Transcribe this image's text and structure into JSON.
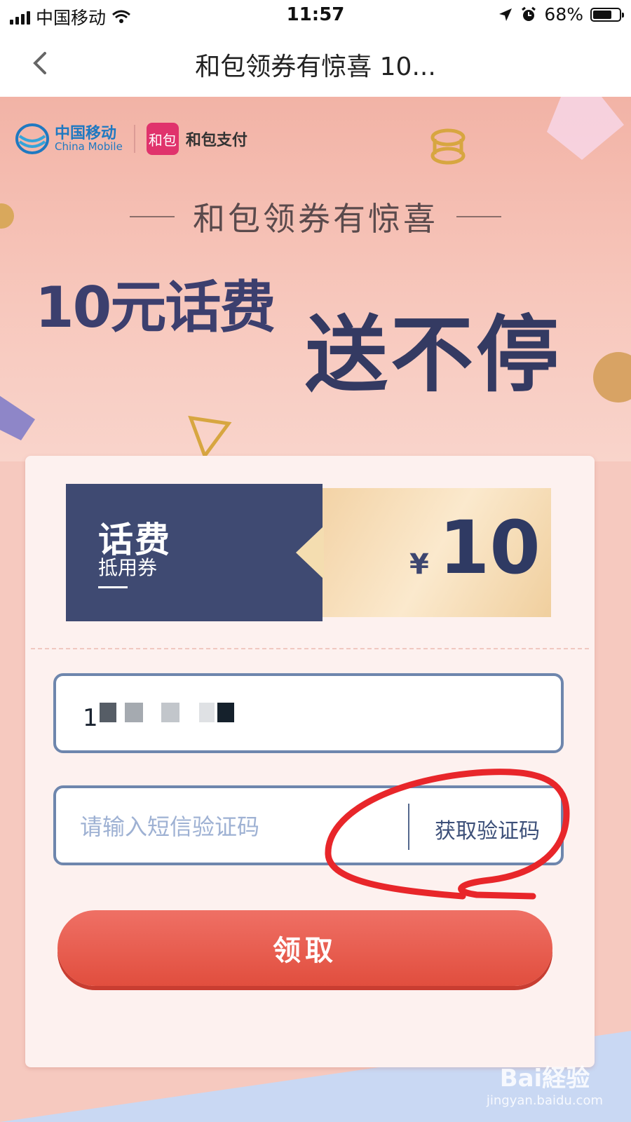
{
  "status_bar": {
    "carrier": "中国移动",
    "time": "11:57",
    "battery": "68%"
  },
  "nav": {
    "title": "和包领券有惊喜 10..."
  },
  "banner": {
    "brand_cn": "中国移动",
    "brand_en": "China Mobile",
    "hebao_icon": "和包",
    "hebao_text": "和包支付",
    "subtitle": "和包领券有惊喜",
    "headline_1": "10元话费",
    "headline_2": "送不停"
  },
  "coupon": {
    "title": "话费",
    "subtitle": "抵用券",
    "currency": "¥",
    "amount": "10"
  },
  "form": {
    "phone_value": "1",
    "code_placeholder": "请输入短信验证码",
    "get_code_label": "获取验证码",
    "claim_label": "领取"
  },
  "watermark": {
    "main": "Bai経验",
    "url": "jingyan.baidu.com"
  },
  "colors": {
    "accent": "#e14e3e",
    "navy": "#3f4a72",
    "border": "#6e86ad",
    "annotation": "#e8262a"
  }
}
